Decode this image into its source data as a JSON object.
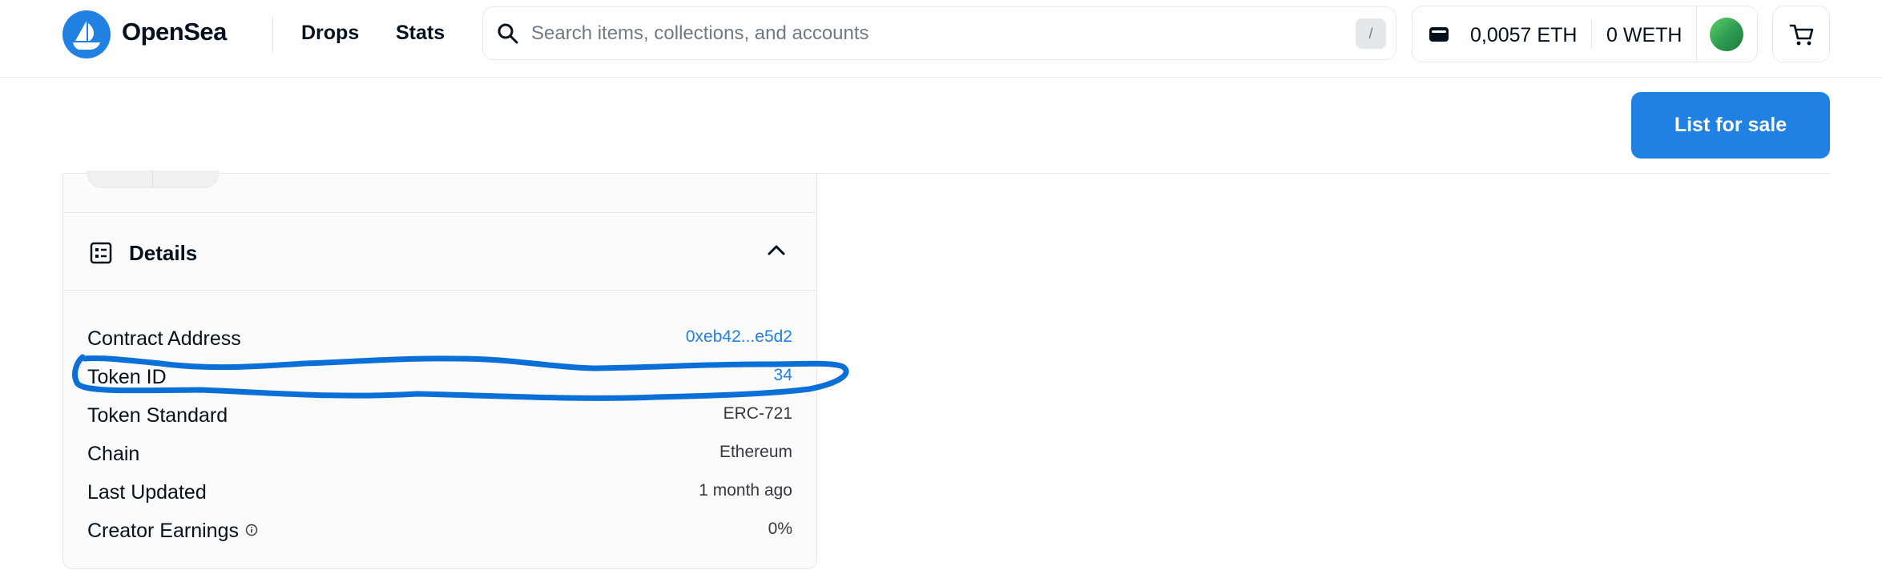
{
  "brand": {
    "name": "OpenSea",
    "logo_icon": "opensea-sailboat-icon"
  },
  "nav": {
    "drops": "Drops",
    "stats": "Stats"
  },
  "search": {
    "placeholder": "Search items, collections, and accounts",
    "shortcut": "/"
  },
  "wallet": {
    "eth_balance": "0,0057 ETH",
    "weth_balance": "0 WETH"
  },
  "actions": {
    "list_for_sale": "List for sale"
  },
  "details": {
    "title": "Details",
    "rows": [
      {
        "label": "Contract Address",
        "value": "0xeb42...e5d2"
      },
      {
        "label": "Token ID",
        "value": "34"
      },
      {
        "label": "Token Standard",
        "value": "ERC-721"
      },
      {
        "label": "Chain",
        "value": "Ethereum"
      },
      {
        "label": "Last Updated",
        "value": "1 month ago"
      },
      {
        "label": "Creator Earnings",
        "value": "0%"
      }
    ]
  },
  "colors": {
    "accent": "#2081e2",
    "annotation": "#0a6fd6",
    "text": "#04111d",
    "border": "#e5e8eb"
  }
}
